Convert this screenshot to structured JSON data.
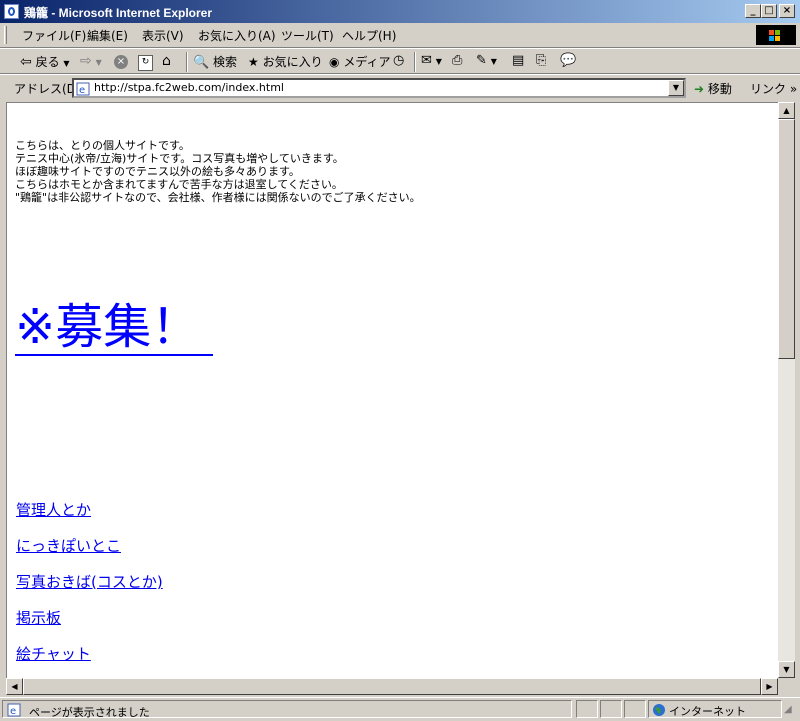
{
  "window": {
    "title": "鶏籠 - Microsoft Internet Explorer"
  },
  "caption_buttons": {
    "minimize": "_",
    "maximize": "□",
    "close": "×"
  },
  "menu": [
    "ファイル(F)",
    "編集(E)",
    "表示(V)",
    "お気に入り(A)",
    "ツール(T)",
    "ヘルプ(H)"
  ],
  "toolbar": {
    "back": "戻る",
    "search": "検索",
    "favorites": "お気に入り",
    "media": "メディア"
  },
  "address": {
    "label": "アドレス(D)",
    "url": "http://stpa.fc2web.com/index.html",
    "go": "移動",
    "links": "リンク"
  },
  "content": {
    "intro": [
      "こちらは、とりの個人サイトです。",
      "テニス中心(氷帝/立海)サイトです。コス写真も増やしていきます。",
      "ほぼ趣味サイトですのでテニス以外の絵も多々あります。",
      "こちらはホモとか含まれてますんで苦手な方は退室してください。",
      "\"鶏籠\"は非公認サイトなので、会社様、作者様には関係ないのでご了承ください。"
    ],
    "recruit": "※募集！",
    "links": [
      "管理人とか",
      "にっきぽいとこ",
      "写真おきば(コスとか)",
      "掲示板",
      "絵チャット"
    ]
  },
  "status": {
    "text": "ページが表示されました",
    "zone": "インターネット"
  },
  "colors": {
    "title_start": "#0a246a",
    "title_end": "#a6caf0",
    "link": "#0000ee",
    "chrome": "#d4d0c8"
  }
}
